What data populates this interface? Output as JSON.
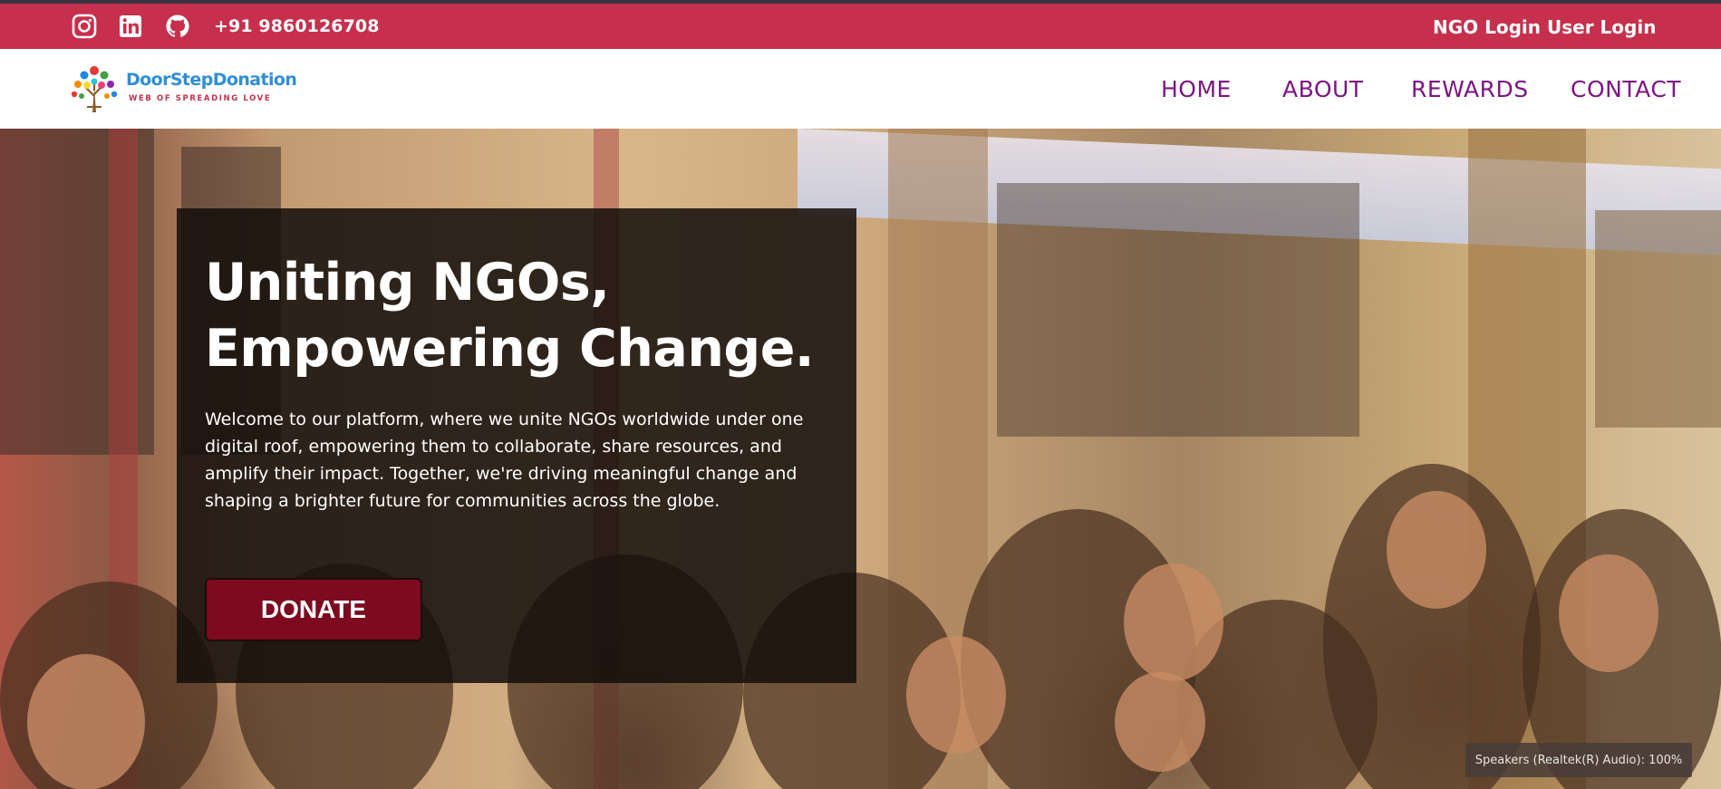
{
  "topbar": {
    "social_icons": [
      "instagram-icon",
      "linkedin-icon",
      "github-icon"
    ],
    "phone": "+91 9860126708",
    "ngo_login": "NGO Login",
    "user_login": "User Login",
    "background_color": "#c6304d"
  },
  "logo": {
    "title": "DoorStepDonation",
    "tagline": "WEB OF SPREADING LOVE"
  },
  "nav": {
    "items": [
      {
        "label": "HOME"
      },
      {
        "label": "ABOUT"
      },
      {
        "label": "REWARDS"
      },
      {
        "label": "CONTACT"
      }
    ],
    "link_color": "#7c1683"
  },
  "hero": {
    "title_line1": "Uniting NGOs,",
    "title_line2": "Empowering Change.",
    "description": "Welcome to our platform, where we unite NGOs worldwide under one digital roof, empowering them to collaborate, share resources, and amplify their impact. Together, we're driving meaningful change and shaping a brighter future for communities across the globe.",
    "donate_label": "DONATE",
    "button_color": "#7d0a1f"
  },
  "system": {
    "volume_toast": "Speakers (Realtek(R) Audio): 100%"
  }
}
